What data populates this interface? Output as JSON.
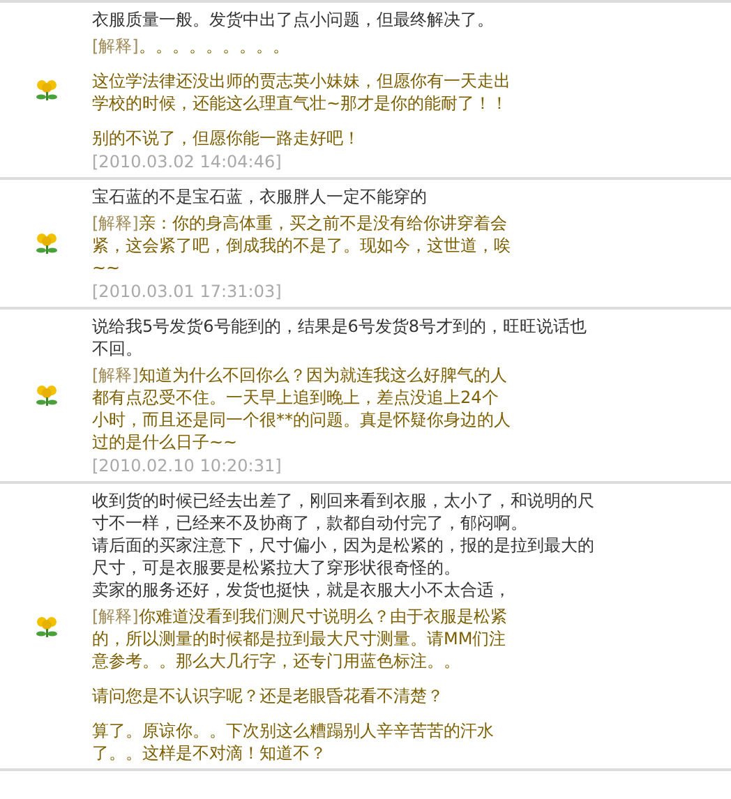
{
  "reviews": [
    {
      "text": [
        "衣服质量一般。发货中出了点小问题，但最终解决了。"
      ],
      "reply": {
        "label": "[解释]",
        "paragraphs": [
          "。。。。。。。。。",
          "这位学法律还没出师的贾志英小妹妹，但愿你有一天走出学校的时候，还能这么理直气壮~那才是你的能耐了！！",
          "别的不说了，但愿你能一路走好吧！"
        ]
      },
      "time": "[2010.03.02 14:04:46]"
    },
    {
      "text": [
        "宝石蓝的不是宝石蓝，衣服胖人一定不能穿的"
      ],
      "reply": {
        "label": "[解释]",
        "paragraphs": [
          "亲：你的身高体重，买之前不是没有给你讲穿着会紧，这会紧了吧，倒成我的不是了。现如今，这世道，唉~~"
        ]
      },
      "time": "[2010.03.01 17:31:03]"
    },
    {
      "text": [
        "说给我5号发货6号能到的，结果是6号发货8号才到的，旺旺说话也不回。"
      ],
      "reply": {
        "label": "[解释]",
        "paragraphs": [
          "知道为什么不回你么？因为就连我这么好脾气的人都有点忍受不住。一天早上追到晚上，差点没追上24个小时，而且还是同一个很**的问题。真是怀疑你身边的人过的是什么日子~~"
        ]
      },
      "time": "[2010.02.10 10:20:31]"
    },
    {
      "text": [
        "收到货的时候已经去出差了，刚回来看到衣服，太小了，和说明的尺寸不一样，已经来不及协商了，款都自动付完了，郁闷啊。",
        "请后面的买家注意下，尺寸偏小，因为是松紧的，报的是拉到最大的尺寸，可是衣服要是松紧拉大了穿形状很奇怪的。",
        "卖家的服务还好，发货也挺快，就是衣服大小不太合适，"
      ],
      "reply": {
        "label": "[解释]",
        "paragraphs": [
          "你难道没看到我们测尺寸说明么？由于衣服是松紧的，所以测量的时候都是拉到最大尺寸测量。请MM们注意参考。。那么大几行字，还专门用蓝色标注。。",
          "请问您是不认识字呢？还是老眼昏花看不清楚？",
          "算了。原谅你。。下次别这么糟蹋别人辛辛苦苦的汗水了。。这样是不对滴！知道不？"
        ]
      }
    }
  ]
}
